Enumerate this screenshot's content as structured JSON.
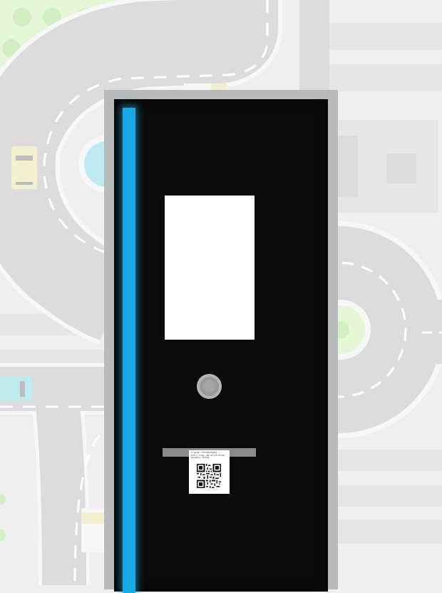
{
  "scene": {
    "map_colors": {
      "road": "#dcdcdc",
      "road_border": "#f7f7f7",
      "lane_mark": "#ffffff",
      "park": "#e6f7d7",
      "tree": "#d3efc4",
      "block": "#e6e6e6",
      "water": "#bfeaf3",
      "car_yellow": "#f3f0cf",
      "car_cyan": "#c0ebee"
    }
  },
  "kiosk": {
    "accent_color": "#19a9e6",
    "frame_color": "#b9babb",
    "body_color": "#0b0b0b",
    "screen_content": "",
    "button_icon": "round-button-icon",
    "receipt": {
      "lines": [
        "Crypt#: 3f7c0d9f4e5a",
        "Entry Time: 06/12 07:52:04",
        "Payable: P1234"
      ],
      "qr_icon": "qr-code-icon"
    }
  }
}
